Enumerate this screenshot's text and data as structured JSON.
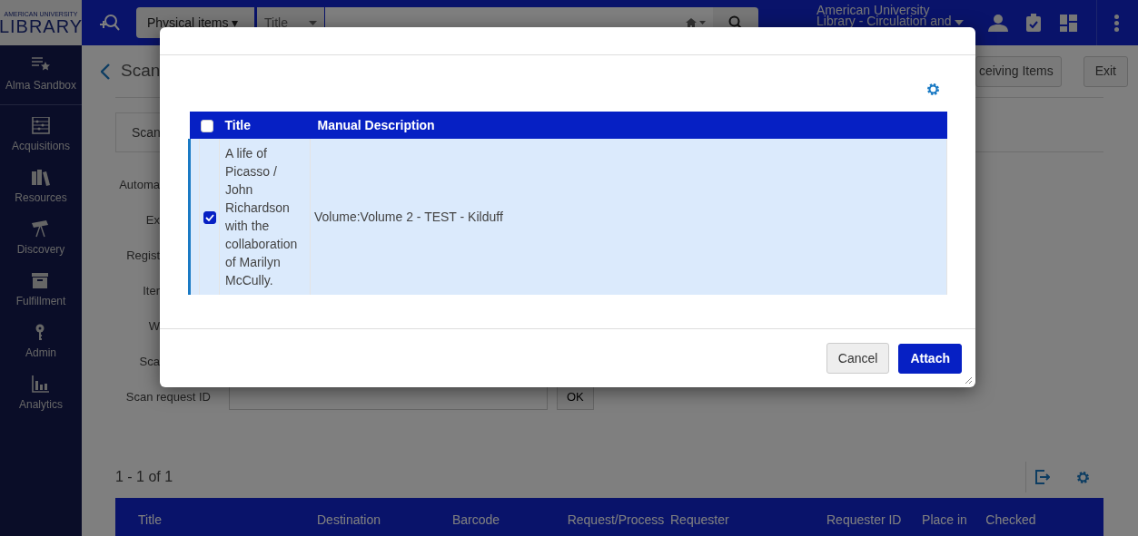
{
  "topbar": {
    "logo_caption": "AMERICAN UNIVERSITY",
    "logo": "LIBRARY",
    "search_scope": "Physical items ▾",
    "search_field": "Title",
    "institution": "American University Library - Circulation and"
  },
  "sidebar": {
    "items": [
      {
        "label": "Alma Sandbox"
      },
      {
        "label": "Acquisitions"
      },
      {
        "label": "Resources"
      },
      {
        "label": "Discovery"
      },
      {
        "label": "Fulfillment"
      },
      {
        "label": "Admin"
      },
      {
        "label": "Analytics"
      }
    ]
  },
  "page": {
    "title": "Scan",
    "header_buttons": [
      "ceiving Items",
      "Exit"
    ],
    "tabs": [
      {
        "label": "Scan",
        "selected": true
      }
    ],
    "form_labels": [
      "Automa",
      "Ex",
      "Regist",
      "Iter",
      "W",
      "Sca"
    ],
    "scan_request": {
      "label": "Scan request ID",
      "button": "OK"
    },
    "results_count": "1 - 1 of 1",
    "columns": [
      "Title",
      "Destination",
      "Barcode",
      "Request/Process",
      "Requester",
      "Requester ID",
      "Place in",
      "Checked"
    ]
  },
  "modal": {
    "select_all_checked": false,
    "columns": [
      "Title",
      "Manual Description"
    ],
    "rows": [
      {
        "selected": true,
        "title": "A life of Picasso / John Richardson with the collaboration of Marilyn McCully.",
        "description": "Volume:Volume 2 - TEST - Kilduff"
      }
    ],
    "buttons": [
      {
        "label": "Cancel",
        "kind": "secondary"
      },
      {
        "label": "Attach",
        "kind": "primary"
      }
    ]
  }
}
